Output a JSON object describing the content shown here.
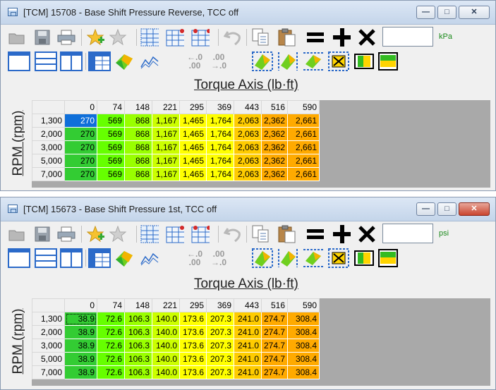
{
  "windows": [
    {
      "title": "[TCM] 15708 - Base Shift Pressure Reverse, TCC off",
      "unit": "kPa",
      "axis_title": "Torque Axis (lb·ft)",
      "row_axis_label": "RPM (rpm)",
      "columns": [
        "0",
        "74",
        "148",
        "221",
        "295",
        "369",
        "443",
        "516",
        "590"
      ],
      "rows": [
        {
          "rpm": "1,300",
          "values": [
            "270",
            "569",
            "868",
            "1,167",
            "1,465",
            "1,764",
            "2,063",
            "2,362",
            "2,661"
          ]
        },
        {
          "rpm": "2,000",
          "values": [
            "270",
            "569",
            "868",
            "1,167",
            "1,465",
            "1,764",
            "2,063",
            "2,362",
            "2,661"
          ]
        },
        {
          "rpm": "3,000",
          "values": [
            "270",
            "569",
            "868",
            "1,167",
            "1,465",
            "1,764",
            "2,063",
            "2,362",
            "2,661"
          ]
        },
        {
          "rpm": "5,000",
          "values": [
            "270",
            "569",
            "868",
            "1,167",
            "1,465",
            "1,764",
            "2,063",
            "2,362",
            "2,661"
          ]
        },
        {
          "rpm": "7,000",
          "values": [
            "270",
            "569",
            "868",
            "1,167",
            "1,465",
            "1,764",
            "2,063",
            "2,362",
            "2,661"
          ]
        }
      ]
    },
    {
      "title": "[TCM] 15673 - Base Shift Pressure 1st, TCC off",
      "unit": "psi",
      "axis_title": "Torque Axis (lb·ft)",
      "row_axis_label": "RPM (rpm)",
      "columns": [
        "0",
        "74",
        "148",
        "221",
        "295",
        "369",
        "443",
        "516",
        "590"
      ],
      "rows": [
        {
          "rpm": "1,300",
          "values": [
            "38.9",
            "72.6",
            "106.3",
            "140.0",
            "173.6",
            "207.3",
            "241.0",
            "274.7",
            "308.4"
          ]
        },
        {
          "rpm": "2,000",
          "values": [
            "38.9",
            "72.6",
            "106.3",
            "140.0",
            "173.6",
            "207.3",
            "241.0",
            "274.7",
            "308.4"
          ]
        },
        {
          "rpm": "3,000",
          "values": [
            "38.9",
            "72.6",
            "106.3",
            "140.0",
            "173.6",
            "207.3",
            "241.0",
            "274.7",
            "308.4"
          ]
        },
        {
          "rpm": "5,000",
          "values": [
            "38.9",
            "72.6",
            "106.3",
            "140.0",
            "173.6",
            "207.3",
            "241.0",
            "274.7",
            "308.4"
          ]
        },
        {
          "rpm": "7,000",
          "values": [
            "38.9",
            "72.6",
            "106.3",
            "140.0",
            "173.6",
            "207.3",
            "241.0",
            "274.7",
            "308.4"
          ]
        }
      ]
    }
  ],
  "toolbar": {
    "increment_glyph_top": "←.0",
    "increment_glyph_right": ".00",
    "decrement_glyph_top": ".00",
    "decrement_glyph_right": "→.0"
  },
  "colors": {
    "selection": "#0f6fd9",
    "col_colors": [
      "#33cc33",
      "#66ff00",
      "#99ff00",
      "#ccff00",
      "#ffff00",
      "#ffff00",
      "#ffcc00",
      "#ffaa00",
      "#ffaa00"
    ],
    "unit_text": "#1c8a1c"
  }
}
